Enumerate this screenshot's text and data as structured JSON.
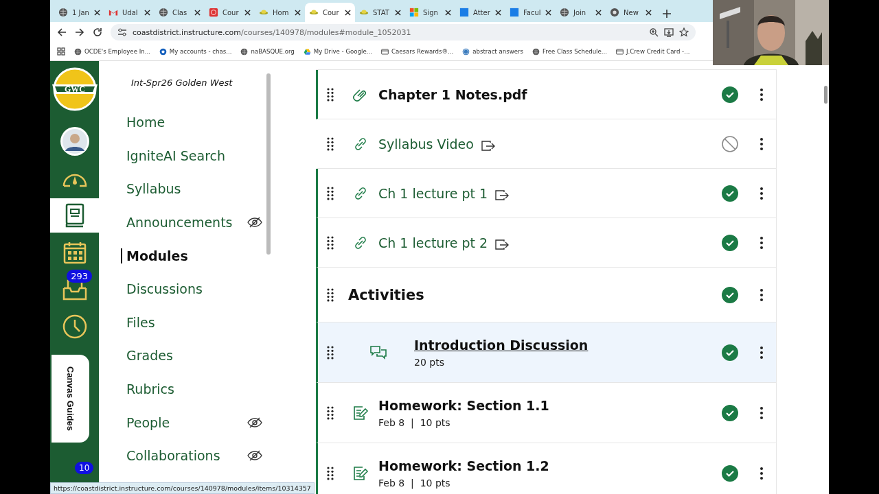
{
  "browser": {
    "tabs": [
      {
        "label": "1 Jan",
        "kind": "globe",
        "selected": false
      },
      {
        "label": "Udal",
        "kind": "mail",
        "selected": false
      },
      {
        "label": "Clas",
        "kind": "globe",
        "selected": false
      },
      {
        "label": "Cour",
        "kind": "red",
        "selected": false
      },
      {
        "label": "Hom",
        "kind": "hat",
        "selected": false
      },
      {
        "label": "Cour",
        "kind": "hat",
        "selected": true
      },
      {
        "label": "STAT",
        "kind": "hat",
        "selected": false
      },
      {
        "label": "Sign",
        "kind": "tiles",
        "selected": false
      },
      {
        "label": "Atter",
        "kind": "blue",
        "selected": false
      },
      {
        "label": "Facul",
        "kind": "blue",
        "selected": false
      },
      {
        "label": "Join",
        "kind": "globe",
        "selected": false
      },
      {
        "label": "New",
        "kind": "chrome",
        "selected": false
      }
    ],
    "url_host": "coastdistrict.instructure.com",
    "url_path": "/courses/140978/modules#module_1052031",
    "bookmarks": [
      {
        "label": "OCDE's Employee In...",
        "kind": "globe"
      },
      {
        "label": "My accounts - chas...",
        "kind": "bank"
      },
      {
        "label": "naBASQUE.org",
        "kind": "globe"
      },
      {
        "label": "My Drive - Google...",
        "kind": "drive"
      },
      {
        "label": "Caesars Rewards®...",
        "kind": "card"
      },
      {
        "label": "abstract answers",
        "kind": "wp"
      },
      {
        "label": "Free Class Schedule...",
        "kind": "globe"
      },
      {
        "label": "J.Crew Credit Card -...",
        "kind": "card"
      }
    ],
    "status_url": "https://coastdistrict.instructure.com/courses/140978/modules/items/10314357"
  },
  "global_nav": {
    "logo_text": "GWC",
    "items": [
      {
        "kind": "avatar",
        "selected": false
      },
      {
        "kind": "dashboard",
        "selected": false
      },
      {
        "kind": "courses",
        "selected": true
      },
      {
        "kind": "calendar",
        "selected": false
      },
      {
        "kind": "inbox",
        "selected": false,
        "badge": "293"
      },
      {
        "kind": "history",
        "selected": false
      }
    ],
    "guides_tab": "Canvas Guides",
    "bottom_badge": "10"
  },
  "course_nav": {
    "title": "Int-Spr26 Golden West",
    "items": [
      {
        "label": "Home",
        "selected": false,
        "hidden": false
      },
      {
        "label": "IgniteAI Search",
        "selected": false,
        "hidden": false
      },
      {
        "label": "Syllabus",
        "selected": false,
        "hidden": false
      },
      {
        "label": "Announcements",
        "selected": false,
        "hidden": true
      },
      {
        "label": "Modules",
        "selected": true,
        "hidden": false
      },
      {
        "label": "Discussions",
        "selected": false,
        "hidden": false
      },
      {
        "label": "Files",
        "selected": false,
        "hidden": false
      },
      {
        "label": "Grades",
        "selected": false,
        "hidden": false
      },
      {
        "label": "Rubrics",
        "selected": false,
        "hidden": false
      },
      {
        "label": "People",
        "selected": false,
        "hidden": true
      },
      {
        "label": "Collaborations",
        "selected": false,
        "hidden": true
      }
    ]
  },
  "modules": {
    "items": [
      {
        "kind": "file",
        "title": "Chapter 1 Notes.pdf",
        "published": true,
        "external": false,
        "highlighted": false
      },
      {
        "kind": "link",
        "title": "Syllabus Video",
        "published": false,
        "external": true,
        "highlighted": false
      },
      {
        "kind": "link",
        "title": "Ch 1 lecture pt 1",
        "published": true,
        "external": true,
        "highlighted": false
      },
      {
        "kind": "link",
        "title": "Ch 1 lecture pt 2",
        "published": true,
        "external": true,
        "highlighted": false
      },
      {
        "kind": "header",
        "title": "Activities",
        "published": true,
        "external": false,
        "highlighted": false,
        "children": [
          {
            "kind": "discussion",
            "title": "Introduction Discussion",
            "detail": "20 pts",
            "published": true,
            "external": false,
            "highlighted": true
          }
        ]
      },
      {
        "kind": "assignment",
        "title": "Homework: Section 1.1",
        "detail": "Feb 8  |  10 pts",
        "published": true,
        "external": false,
        "highlighted": false
      },
      {
        "kind": "assignment",
        "title": "Homework: Section 1.2",
        "detail": "Feb 8  |  10 pts",
        "published": true,
        "external": false,
        "highlighted": false
      }
    ]
  }
}
